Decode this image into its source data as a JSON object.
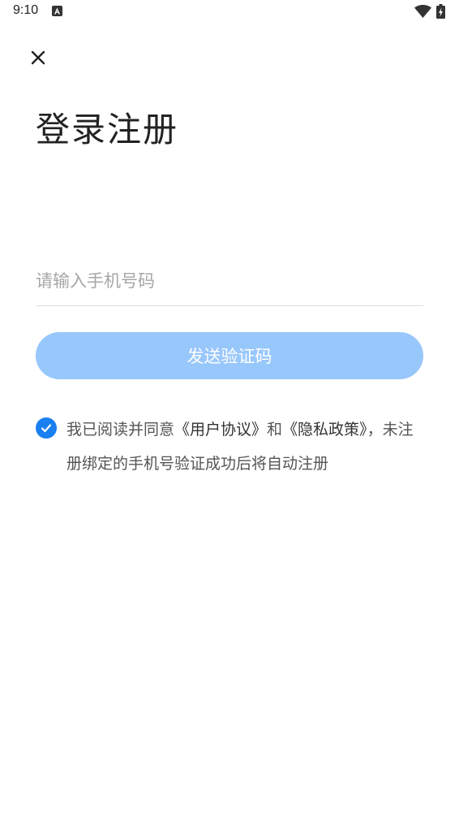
{
  "status_bar": {
    "time": "9:10",
    "notification_icon": "a-letter-icon",
    "wifi_icon": "wifi-icon",
    "battery_icon": "battery-charging-icon"
  },
  "header": {
    "close_icon": "close-icon",
    "title": "登录注册"
  },
  "form": {
    "phone_placeholder": "请输入手机号码",
    "phone_value": "",
    "send_code_label": "发送验证码",
    "send_code_color": "#98c7fb"
  },
  "agreement": {
    "checked": true,
    "checkbox_color": "#1a7ff0",
    "prefix": "我已阅读并同意",
    "user_agreement": "《用户协议》",
    "conjunction": "和",
    "privacy_policy": "《隐私政策》",
    "suffix": "，未注册绑定的手机号验证成功后将自动注册"
  }
}
